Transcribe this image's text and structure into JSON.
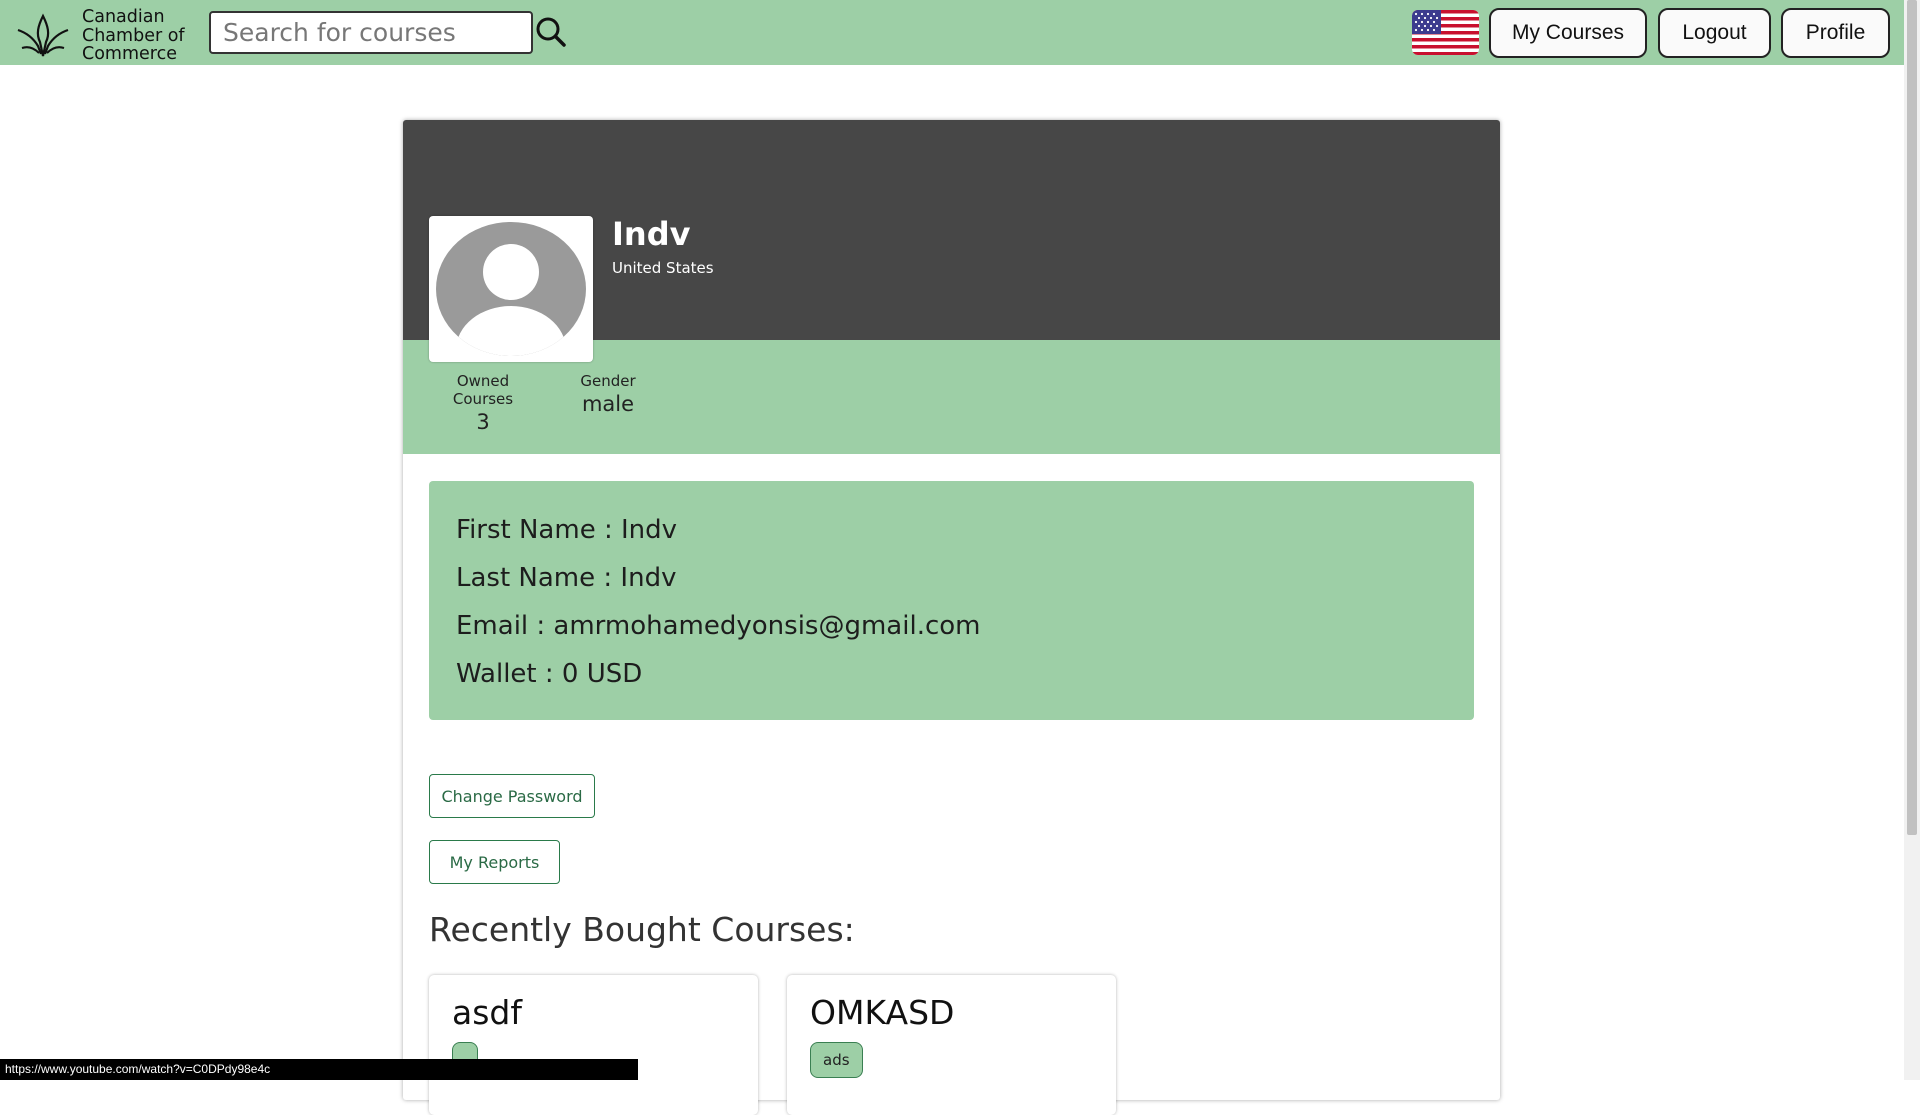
{
  "brand": {
    "name_lines": [
      "Canadian",
      "Chamber of",
      "Commerce"
    ]
  },
  "search": {
    "placeholder": "Search for courses",
    "value": ""
  },
  "nav": {
    "language_flag": "us-flag-icon",
    "my_courses": "My Courses",
    "logout": "Logout",
    "profile": "Profile"
  },
  "profile": {
    "name": "Indv",
    "country": "United States",
    "stats": {
      "owned_courses_label": "Owned Courses",
      "owned_courses_value": "3",
      "gender_label": "Gender",
      "gender_value": "male"
    },
    "info": {
      "first_name": "First Name : Indv",
      "last_name": "Last Name : Indv",
      "email": "Email : amrmohamedyonsis@gmail.com",
      "wallet": "Wallet : 0 USD"
    },
    "change_password": "Change Password",
    "my_reports": "My Reports"
  },
  "recent": {
    "title": "Recently Bought Courses:",
    "courses": [
      {
        "title": "asdf",
        "tag": ""
      },
      {
        "title": "OMKASD",
        "tag": "ads"
      }
    ]
  },
  "status_bar": {
    "url": "https://www.youtube.com/watch?v=C0DPdy98e4c"
  },
  "colors": {
    "accent": "#9dcfa6",
    "cover": "#474747",
    "button_border": "#2a7a4a"
  }
}
